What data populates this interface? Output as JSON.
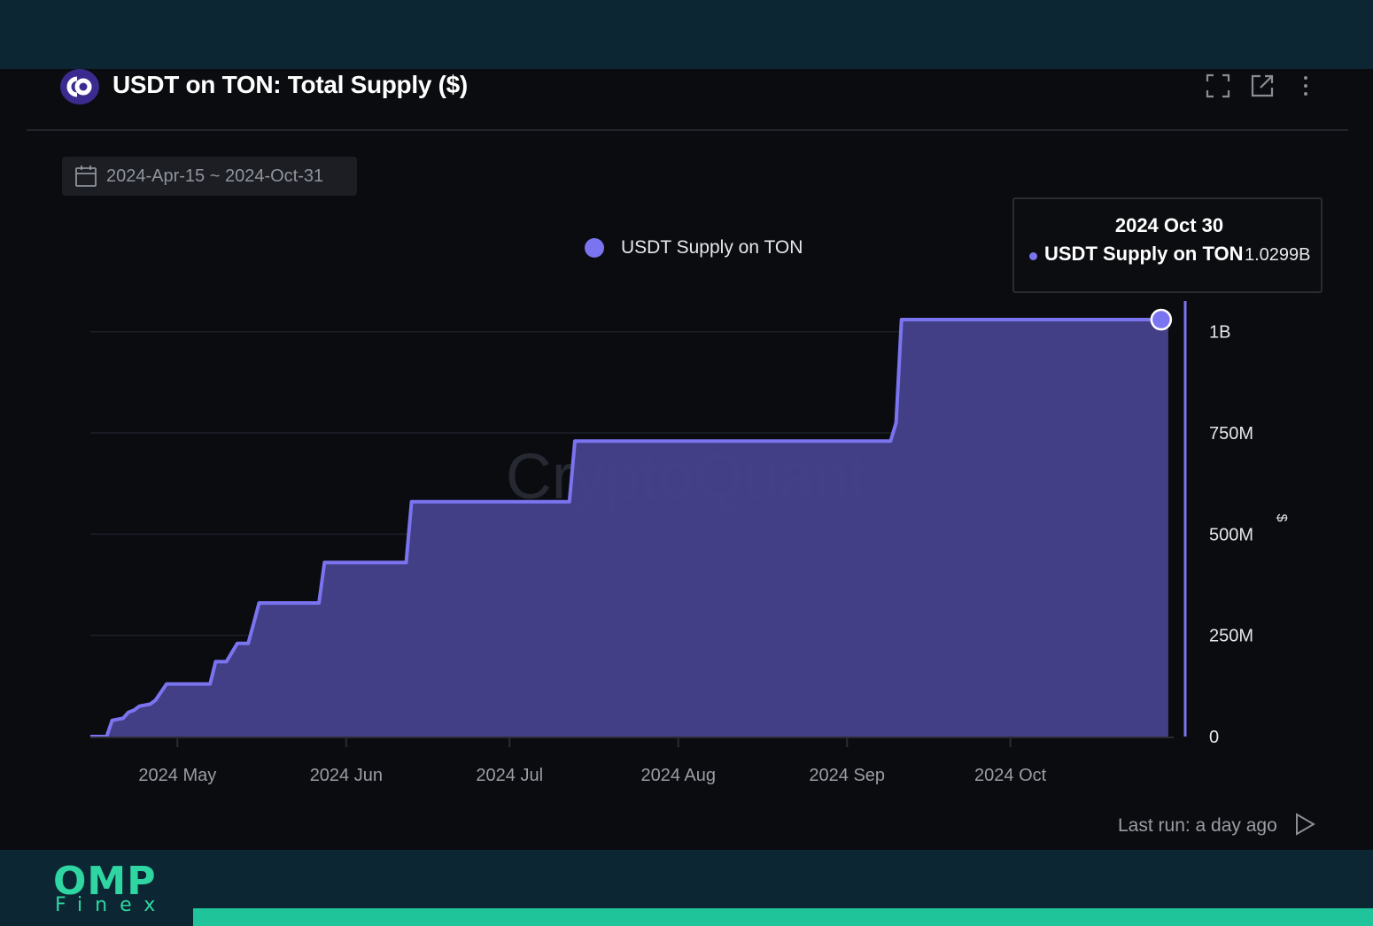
{
  "header": {
    "title": "USDT on TON: Total Supply ($)",
    "icons": [
      "expand-icon",
      "external-link-icon",
      "more-vertical-icon"
    ]
  },
  "date_range": {
    "label": "2024-Apr-15 ~ 2024-Oct-31"
  },
  "tooltip": {
    "date": "2024 Oct 30",
    "series": "USDT Supply on TON",
    "value": "1.0299B"
  },
  "watermark": "CryptoQuant",
  "footer": {
    "last_run": "Last run: a day ago"
  },
  "branding": {
    "name": "OMP",
    "sub": "Finex"
  },
  "colors": {
    "accent": "#7b74f0",
    "area": "#45418a",
    "panel": "#0b0c10",
    "brand": "#2fd6a2"
  },
  "chart_data": {
    "type": "area",
    "series": [
      {
        "name": "USDT Supply on TON",
        "points": [
          [
            "2024-04-15",
            0
          ],
          [
            "2024-04-18",
            0
          ],
          [
            "2024-04-19",
            40000000
          ],
          [
            "2024-04-21",
            45000000
          ],
          [
            "2024-04-22",
            60000000
          ],
          [
            "2024-04-23",
            65000000
          ],
          [
            "2024-04-24",
            75000000
          ],
          [
            "2024-04-26",
            80000000
          ],
          [
            "2024-04-27",
            90000000
          ],
          [
            "2024-04-29",
            130000000
          ],
          [
            "2024-05-07",
            130000000
          ],
          [
            "2024-05-08",
            185000000
          ],
          [
            "2024-05-10",
            185000000
          ],
          [
            "2024-05-12",
            230000000
          ],
          [
            "2024-05-14",
            230000000
          ],
          [
            "2024-05-15",
            280000000
          ],
          [
            "2024-05-16",
            330000000
          ],
          [
            "2024-05-27",
            330000000
          ],
          [
            "2024-05-28",
            430000000
          ],
          [
            "2024-06-12",
            430000000
          ],
          [
            "2024-06-13",
            580000000
          ],
          [
            "2024-07-12",
            580000000
          ],
          [
            "2024-07-13",
            730000000
          ],
          [
            "2024-09-09",
            730000000
          ],
          [
            "2024-09-10",
            775000000
          ],
          [
            "2024-09-11",
            1030000000
          ],
          [
            "2024-10-30",
            1030000000
          ]
        ]
      }
    ],
    "x_ticks": [
      "2024 May",
      "2024 Jun",
      "2024 Jul",
      "2024 Aug",
      "2024 Sep",
      "2024 Oct"
    ],
    "x_tick_dates": [
      "2024-05-01",
      "2024-06-01",
      "2024-07-01",
      "2024-08-01",
      "2024-09-01",
      "2024-10-01"
    ],
    "xlim": [
      "2024-04-15",
      "2024-10-31"
    ],
    "y_ticks": [
      0,
      250000000,
      500000000,
      750000000,
      1000000000
    ],
    "y_tick_labels": [
      "0",
      "250M",
      "500M",
      "750M",
      "1B"
    ],
    "ylim": [
      0,
      1030000000
    ],
    "ylabel": "$",
    "grid": true,
    "legend": "top-center",
    "highlight": {
      "date": "2024-10-30",
      "value": 1029900000
    }
  }
}
